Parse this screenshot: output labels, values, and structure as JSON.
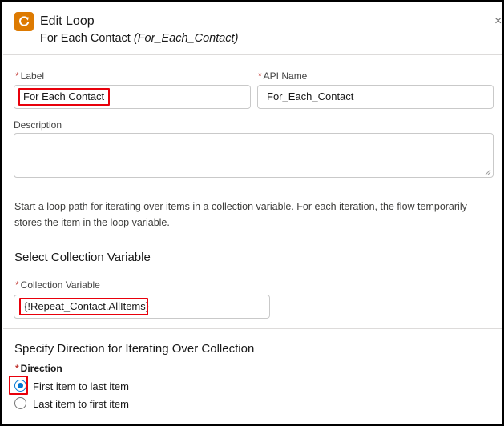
{
  "header": {
    "title": "Edit Loop",
    "subtitle_name": "For Each Contact",
    "subtitle_api": "(For_Each_Contact)",
    "close_glyph": "×",
    "icon": "loop-icon"
  },
  "fields": {
    "required_marker": "*",
    "label": {
      "label": "Label",
      "value": "For Each Contact"
    },
    "api_name": {
      "label": "API Name",
      "value": "For_Each_Contact"
    },
    "description": {
      "label": "Description",
      "value": ""
    }
  },
  "help_text": "Start a loop path for iterating over items in a collection variable. For each iteration, the flow temporarily stores the item in the loop variable.",
  "collection_section": {
    "title": "Select Collection Variable",
    "field_label": "Collection Variable",
    "value": "{!Repeat_Contact.AllItems}"
  },
  "direction_section": {
    "title": "Specify Direction for Iterating Over Collection",
    "field_label": "Direction",
    "options": [
      {
        "label": "First item to last item",
        "selected": true
      },
      {
        "label": "Last item to first item",
        "selected": false
      }
    ]
  },
  "colors": {
    "accent": "#0176d3",
    "highlight": "#e8000b",
    "loop_icon": "#dd7a01",
    "required": "#c23934"
  }
}
